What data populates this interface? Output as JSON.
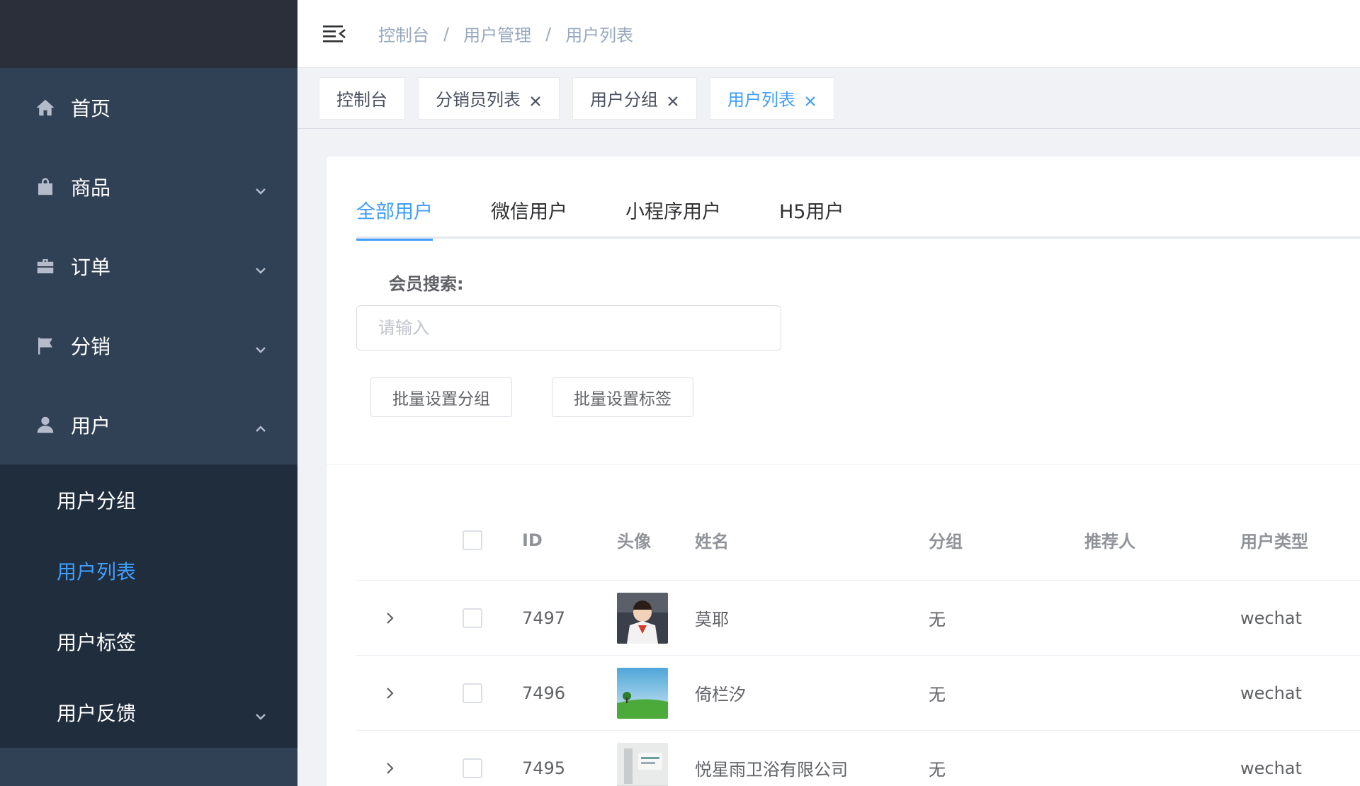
{
  "sidebar": {
    "items": [
      {
        "label": "首页",
        "icon": "home-icon",
        "has_children": false
      },
      {
        "label": "商品",
        "icon": "shopping-bag-icon",
        "has_children": true,
        "expanded": false
      },
      {
        "label": "订单",
        "icon": "briefcase-icon",
        "has_children": true,
        "expanded": false
      },
      {
        "label": "分销",
        "icon": "flag-icon",
        "has_children": true,
        "expanded": false
      },
      {
        "label": "用户",
        "icon": "user-icon",
        "has_children": true,
        "expanded": true
      }
    ],
    "sub_items": [
      {
        "label": "用户分组",
        "active": false
      },
      {
        "label": "用户列表",
        "active": true
      },
      {
        "label": "用户标签",
        "active": false
      },
      {
        "label": "用户反馈",
        "active": false,
        "has_children": true
      }
    ]
  },
  "header": {
    "breadcrumb": [
      "控制台",
      "用户管理",
      "用户列表"
    ],
    "separator": "/"
  },
  "tags": [
    {
      "label": "控制台",
      "closable": false,
      "active": false
    },
    {
      "label": "分销员列表",
      "closable": true,
      "active": false
    },
    {
      "label": "用户分组",
      "closable": true,
      "active": false
    },
    {
      "label": "用户列表",
      "closable": true,
      "active": true
    }
  ],
  "tabs": [
    {
      "label": "全部用户",
      "active": true
    },
    {
      "label": "微信用户",
      "active": false
    },
    {
      "label": "小程序用户",
      "active": false
    },
    {
      "label": "H5用户",
      "active": false
    }
  ],
  "search": {
    "label": "会员搜索:",
    "placeholder": "请输入",
    "value": ""
  },
  "buttons": {
    "batch_group": "批量设置分组",
    "batch_tag": "批量设置标签"
  },
  "table": {
    "headers": {
      "id": "ID",
      "avatar": "头像",
      "name": "姓名",
      "group": "分组",
      "referrer": "推荐人",
      "user_type": "用户类型"
    },
    "rows": [
      {
        "id": "7497",
        "name": "莫耶",
        "group": "无",
        "referrer": "",
        "user_type": "wechat"
      },
      {
        "id": "7496",
        "name": "倚栏汐",
        "group": "无",
        "referrer": "",
        "user_type": "wechat"
      },
      {
        "id": "7495",
        "name": "悦星雨卫浴有限公司",
        "group": "无",
        "referrer": "",
        "user_type": "wechat"
      }
    ]
  },
  "colors": {
    "sidebar_bg": "#304156",
    "submenu_bg": "#1f2d3d",
    "accent": "#409eff"
  }
}
